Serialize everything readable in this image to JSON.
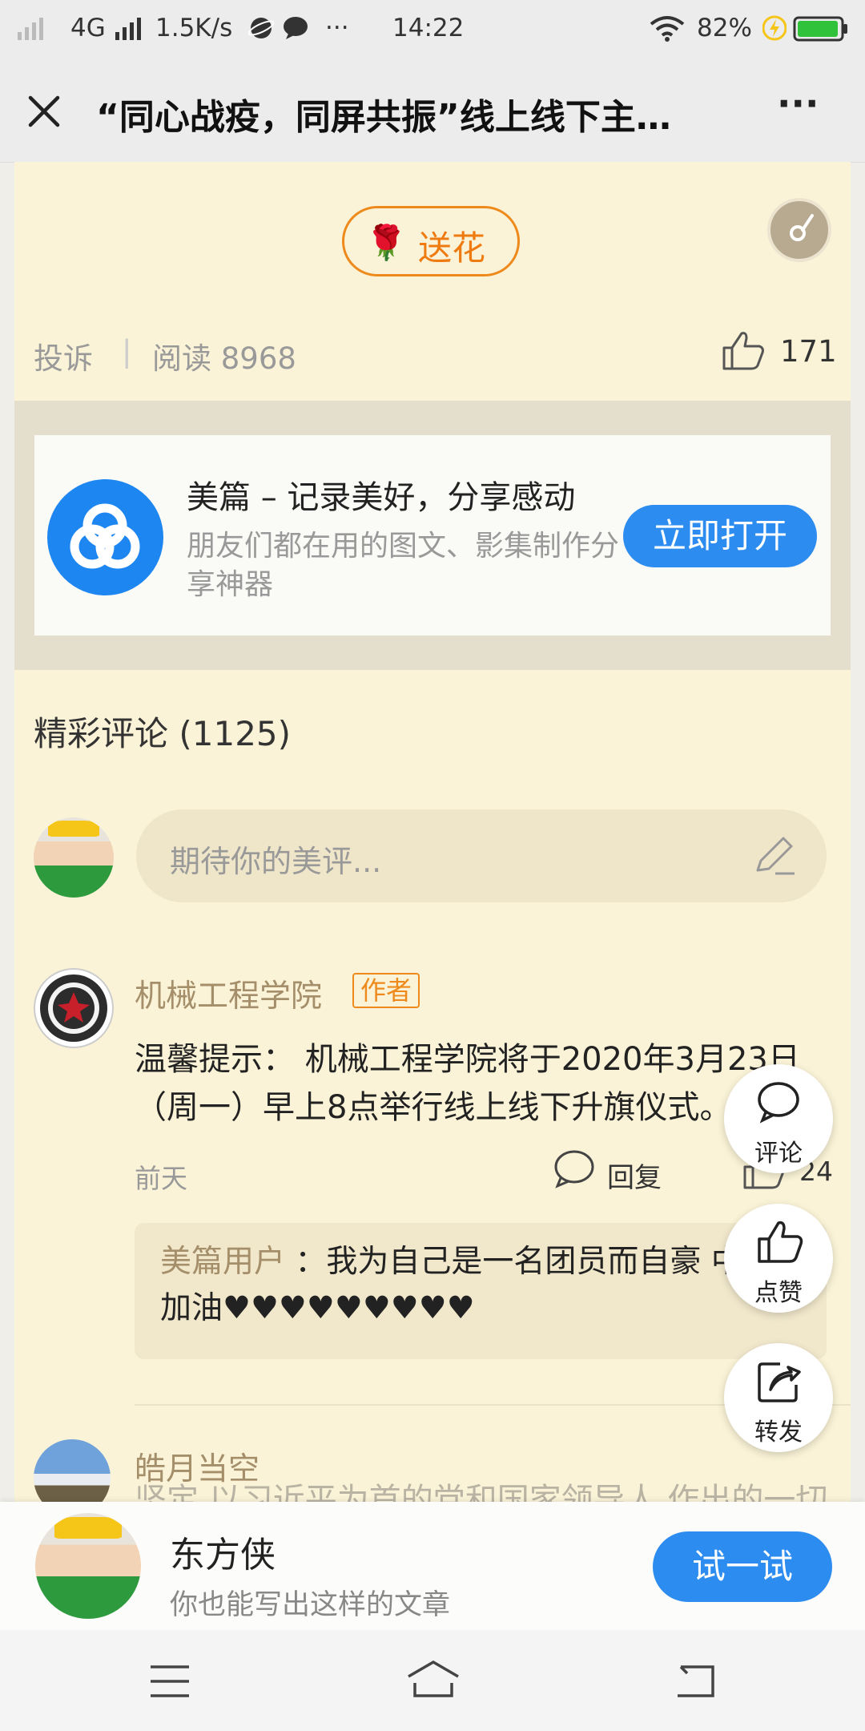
{
  "status": {
    "network": "4G",
    "speed": "1.5K/s",
    "more": "···",
    "time": "14:22",
    "battery": "82%",
    "icons": [
      "signal-icon",
      "signal-icon",
      "browser-icon",
      "chat-icon",
      "wifi-icon",
      "charging-icon",
      "battery-icon"
    ]
  },
  "titlebar": {
    "title": "“同心战疫，同屏共振”线上线下主…",
    "close_icon": "close-icon",
    "more": "···"
  },
  "article": {
    "flower_label": "送花",
    "flower_icon": "🌹",
    "report": "投诉",
    "reads": "阅读 8968",
    "likes": "171"
  },
  "banner": {
    "title": "美篇 – 记录美好，分享感动",
    "subtitle": "朋友们都在用的图文、影集制作分享神器",
    "button": "立即打开"
  },
  "comments": {
    "heading": "精彩评论",
    "count": "(1125)",
    "input_placeholder": "期待你的美评...",
    "items": [
      {
        "name": "机械工程学院",
        "badge": "作者",
        "text": "温馨提示： 机械工程学院将于2020年3月23日（周一）早上8点举行线上线下升旗仪式。",
        "time": "前天",
        "reply_label": "回复",
        "likes": "24",
        "reply": {
          "user": "美篇用户",
          "text": "：我为自己是一名团员而自豪 中国加油♥♥♥♥♥♥♥♥♥"
        }
      },
      {
        "name": "皓月当空",
        "text": "坚定 以习近平为首的党和国家领导人 作出的一切部署 坚决服从一切决议 我们相信这场抗疫情发起的人民战争会早日胜利 伟大的 …全文"
      }
    ]
  },
  "float_actions": [
    {
      "label": "评论",
      "icon": "comment-icon"
    },
    {
      "label": "点赞",
      "icon": "thumbs-up-icon"
    },
    {
      "label": "转发",
      "icon": "share-icon"
    }
  ],
  "promo": {
    "name": "东方侠",
    "subtitle": "你也能写出这样的文章",
    "button": "试一试"
  },
  "navbar": {
    "icons": [
      "menu-icon",
      "home-icon",
      "back-icon"
    ]
  },
  "colors": {
    "content_bg": "#faf3d7",
    "accent_blue": "#2d8cf0",
    "accent_orange": "#ee8a1c",
    "name_color": "#a58e6a"
  }
}
